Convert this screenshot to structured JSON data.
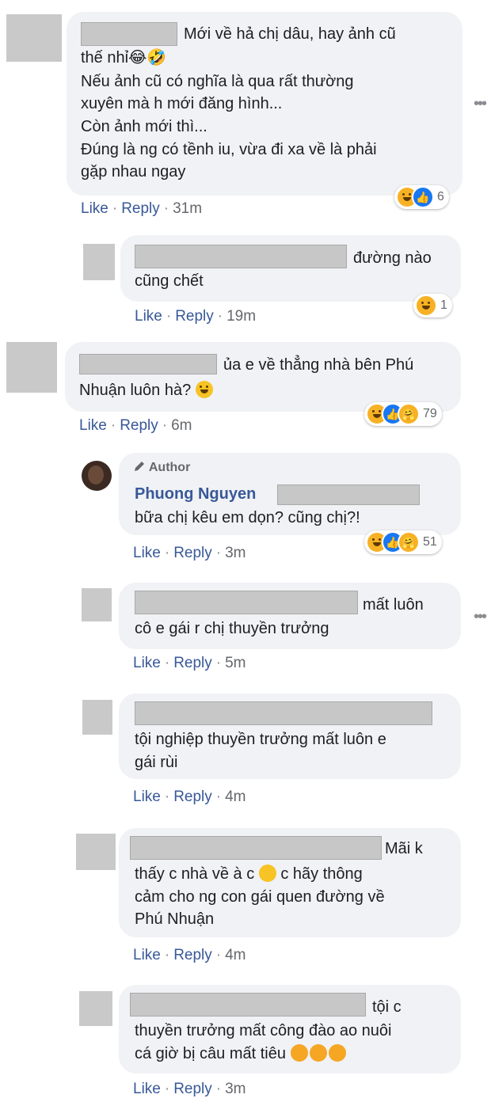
{
  "actions": {
    "like": "Like",
    "reply": "Reply",
    "sep": "·"
  },
  "comments": [
    {
      "lines": [
        "Mới về hả chị dâu, hay ảnh cũ",
        "thế nhỉ😂🤣",
        "Nếu ảnh cũ có nghĩa là qua rất thường",
        "xuyên mà h mới đăng hình...",
        "Còn ảnh mới thì...",
        "Đúng là ng có tềnh iu, vừa đi xa về là phải",
        "gặp nhau ngay"
      ],
      "time": "31m",
      "reactions": {
        "count": "6",
        "icons": [
          "haha-icon",
          "like-icon"
        ]
      }
    },
    {
      "lines": [
        "đường nào",
        "cũng chết"
      ],
      "time": "19m",
      "reactions": {
        "count": "1",
        "icons": [
          "haha-icon"
        ]
      }
    },
    {
      "lines": [
        "ủa e về thẳng nhà bên Phú",
        "Nhuận luôn hà?"
      ],
      "time": "6m",
      "reactions": {
        "count": "79",
        "icons": [
          "haha-icon",
          "like-icon",
          "care-icon"
        ]
      }
    },
    {
      "author_badge": "Author",
      "name": "Phuong Nguyen",
      "lines": [
        "bữa chị kêu em dọn? cũng chị?!"
      ],
      "time": "3m",
      "reactions": {
        "count": "51",
        "icons": [
          "haha-icon",
          "like-icon",
          "care-icon"
        ]
      }
    },
    {
      "lines": [
        "mất luôn",
        "cô e gái r chị thuyền trưởng"
      ],
      "time": "5m"
    },
    {
      "lines": [
        "tội nghiệp thuyền trưởng mất luôn e",
        "gái rùi"
      ],
      "time": "4m"
    },
    {
      "lines": [
        "Mãi k",
        "thấy c nhà về à c",
        "c hãy thông",
        "cảm cho ng con gái quen đường về",
        "Phú Nhuận"
      ],
      "time": "4m"
    },
    {
      "lines": [
        "tội c",
        "thuyền trưởng mất công đào ao nuôi",
        "cá giờ bị câu mất tiêu"
      ],
      "time": "3m"
    }
  ],
  "emoji": {
    "smile": "smile-icon",
    "pensive": "pensive-icon",
    "cry": "loudly-crying-icon"
  },
  "colors": {
    "link": "#385898",
    "bubble": "#f0f2f5",
    "meta": "#65676b"
  }
}
